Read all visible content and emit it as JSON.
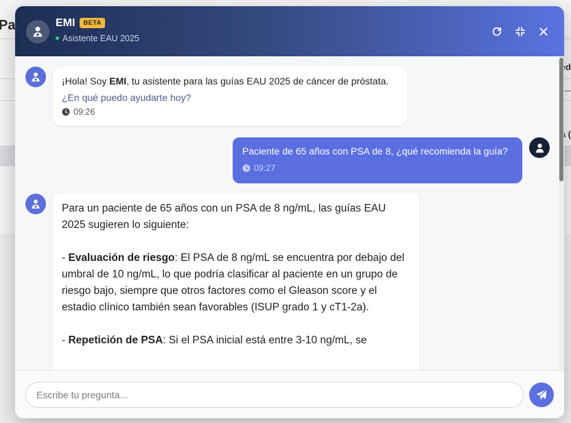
{
  "background": {
    "title_fragment": "Pac",
    "right_fragments": [
      "ed",
      "----",
      "a ("
    ]
  },
  "header": {
    "title": "EMI",
    "badge": "BETA",
    "subtitle": "Asistente EAU 2025",
    "status_color": "#2fd17a"
  },
  "messages": [
    {
      "sender": "bot",
      "greeting_pre": "¡Hola! Soy ",
      "greeting_name": "EMI",
      "greeting_post": ", tu asistente para las guías EAU 2025 de cáncer de próstata.",
      "question": "¿En qué puedo ayudarte hoy?",
      "time": "09:26"
    },
    {
      "sender": "user",
      "text": "Paciente de 65 años con PSA de 8, ¿qué recomienda la guía?",
      "time": "09:27"
    },
    {
      "sender": "bot",
      "intro": "Para un paciente de 65 años con un PSA de 8 ng/mL, las guías EAU 2025 sugieren lo siguiente:",
      "point1_label": "Evaluación de riesgo",
      "point1_text": ": El PSA de 8 ng/mL se encuentra por debajo del umbral de 10 ng/mL, lo que podría clasificar al paciente en un grupo de riesgo bajo, siempre que otros factores como el Gleason score y el estadio clínico también sean favorables (ISUP grado 1 y cT1-2a).",
      "point2_label": "Repetición de PSA",
      "point2_text": ": Si el PSA inicial está entre 3-10 ng/mL, se"
    }
  ],
  "input": {
    "placeholder": "Escribe tu pregunta..."
  },
  "colors": {
    "accent": "#5b6fe0",
    "header_dark": "#1d2e54",
    "badge": "#f2b93b"
  }
}
